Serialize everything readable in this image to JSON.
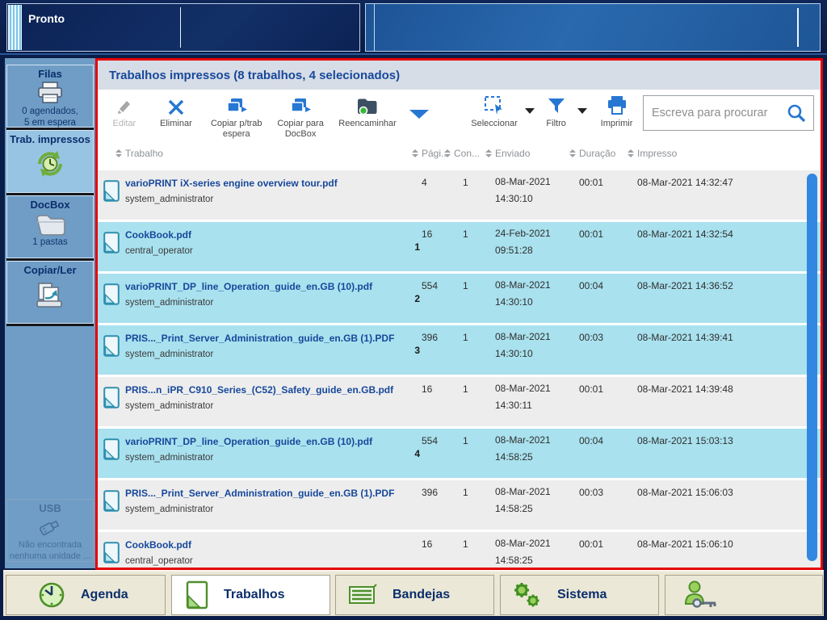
{
  "topbar": {
    "status": "Pronto"
  },
  "sidebar": {
    "items": [
      {
        "label": "Filas",
        "sub": [
          "0 agendados,",
          "5 em espera"
        ],
        "icon": "printer-icon",
        "state": "normal"
      },
      {
        "label": "Trab. impressos",
        "sub": [],
        "icon": "history-clock-icon",
        "state": "selected"
      },
      {
        "label": "DocBox",
        "sub": [
          "1 pastas"
        ],
        "icon": "folder-icon",
        "state": "normal"
      },
      {
        "label": "Copiar/Ler",
        "sub": [],
        "icon": "copy-scan-icon",
        "state": "normal"
      },
      {
        "label": "USB",
        "sub": [
          "Não encontrada",
          "nenhuma unidade ..."
        ],
        "icon": "usb-icon",
        "state": "disabled"
      }
    ]
  },
  "panel": {
    "title": "Trabalhos impressos (8 trabalhos, 4 selecionados)"
  },
  "toolbar": {
    "buttons": [
      {
        "label": "Editar",
        "icon": "pencil-icon",
        "disabled": true
      },
      {
        "label": "Eliminar",
        "icon": "delete-x-icon"
      },
      {
        "label": "Copiar p/trab espera",
        "icon": "copy-icon"
      },
      {
        "label": "Copiar para DocBox",
        "icon": "copy-icon"
      },
      {
        "label": "Reencaminhar",
        "icon": "folder-forward-icon"
      },
      {
        "label": "Seleccionar",
        "icon": "select-area-icon",
        "has_dropdown": true
      },
      {
        "label": "Filtro",
        "icon": "filter-icon",
        "has_dropdown": true
      },
      {
        "label": "Imprimir",
        "icon": "printer-icon"
      }
    ],
    "search_placeholder": "Escreva para procurar"
  },
  "table": {
    "columns": [
      "Trabalho",
      "Pági...",
      "Con...",
      "Enviado",
      "Duração",
      "Impresso"
    ],
    "rows": [
      {
        "name": "varioPRINT iX-series engine overview tour.pdf",
        "owner": "system_administrator",
        "selection_order": "",
        "pages": "4",
        "copies": "1",
        "sent_date": "08-Mar-2021",
        "sent_time": "14:30:10",
        "duration": "00:01",
        "printed": "08-Mar-2021 14:32:47",
        "selected": false
      },
      {
        "name": "CookBook.pdf",
        "owner": "central_operator",
        "selection_order": "1",
        "pages": "16",
        "copies": "1",
        "sent_date": "24-Feb-2021",
        "sent_time": "09:51:28",
        "duration": "00:01",
        "printed": "08-Mar-2021 14:32:54",
        "selected": true
      },
      {
        "name": "varioPRINT_DP_line_Operation_guide_en.GB (10).pdf",
        "owner": "system_administrator",
        "selection_order": "2",
        "pages": "554",
        "copies": "1",
        "sent_date": "08-Mar-2021",
        "sent_time": "14:30:10",
        "duration": "00:04",
        "printed": "08-Mar-2021 14:36:52",
        "selected": true
      },
      {
        "name": "PRIS..._Print_Server_Administration_guide_en.GB (1).PDF",
        "owner": "system_administrator",
        "selection_order": "3",
        "pages": "396",
        "copies": "1",
        "sent_date": "08-Mar-2021",
        "sent_time": "14:30:10",
        "duration": "00:03",
        "printed": "08-Mar-2021 14:39:41",
        "selected": true
      },
      {
        "name": "PRIS...n_iPR_C910_Series_(C52)_Safety_guide_en.GB.pdf",
        "owner": "system_administrator",
        "selection_order": "",
        "pages": "16",
        "copies": "1",
        "sent_date": "08-Mar-2021",
        "sent_time": "14:30:11",
        "duration": "00:01",
        "printed": "08-Mar-2021 14:39:48",
        "selected": false
      },
      {
        "name": "varioPRINT_DP_line_Operation_guide_en.GB (10).pdf",
        "owner": "system_administrator",
        "selection_order": "4",
        "pages": "554",
        "copies": "1",
        "sent_date": "08-Mar-2021",
        "sent_time": "14:58:25",
        "duration": "00:04",
        "printed": "08-Mar-2021 15:03:13",
        "selected": true
      },
      {
        "name": "PRIS..._Print_Server_Administration_guide_en.GB (1).PDF",
        "owner": "system_administrator",
        "selection_order": "",
        "pages": "396",
        "copies": "1",
        "sent_date": "08-Mar-2021",
        "sent_time": "14:58:25",
        "duration": "00:03",
        "printed": "08-Mar-2021 15:06:03",
        "selected": false
      },
      {
        "name": "CookBook.pdf",
        "owner": "central_operator",
        "selection_order": "",
        "pages": "16",
        "copies": "1",
        "sent_date": "08-Mar-2021",
        "sent_time": "14:58:25",
        "duration": "00:01",
        "printed": "08-Mar-2021 15:06:10",
        "selected": false
      }
    ]
  },
  "tabs": [
    {
      "label": "Agenda",
      "icon": "clock-icon",
      "active": false
    },
    {
      "label": "Trabalhos",
      "icon": "document-icon",
      "active": true
    },
    {
      "label": "Bandejas",
      "icon": "trays-icon",
      "active": false
    },
    {
      "label": "Sistema",
      "icon": "gears-icon",
      "active": false
    },
    {
      "label": "",
      "icon": "user-key-icon",
      "active": false
    }
  ],
  "colors": {
    "accent_blue": "#2677d2",
    "selected_row": "#a9e1ee",
    "alert_border": "#e60000",
    "sidebar_blue": "#6f9dc6",
    "scrollbar": "#3287e0",
    "bottombar": "#ebe8d7"
  }
}
